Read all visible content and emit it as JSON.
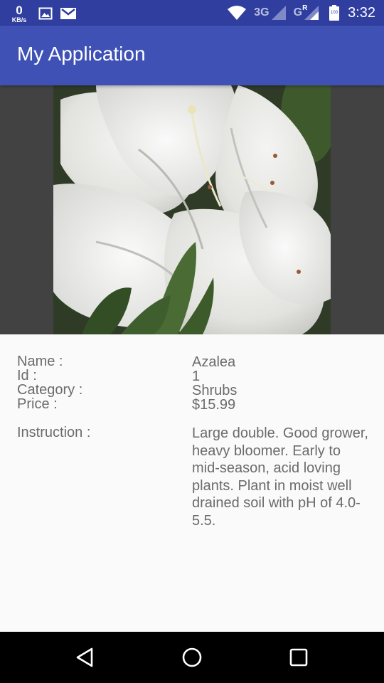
{
  "status_bar": {
    "net_speed_value": "0",
    "net_speed_unit": "KB/s",
    "network_3g_label": "3G",
    "network_g_label": "G",
    "roaming_label": "R",
    "battery_level": "100",
    "clock": "3:32",
    "icons": [
      "image-icon",
      "gmail-icon",
      "wifi-icon",
      "signal-icon",
      "battery-icon"
    ]
  },
  "app_bar": {
    "title": "My Application"
  },
  "plant": {
    "image_icon": "plant-photo"
  },
  "details": {
    "name_label": "Name :",
    "name_value": "Azalea",
    "id_label": "Id :",
    "id_value": "1",
    "category_label": "Category :",
    "category_value": "Shrubs",
    "price_label": "Price :",
    "price_value": "$15.99",
    "instruction_label": "Instruction :",
    "instruction_value": "Large double. Good grower, heavy bloomer. Early to mid-season, acid loving plants. Plant in moist well drained soil with pH of 4.0-5.5."
  },
  "nav_bar": {
    "icons": [
      "back-icon",
      "home-icon",
      "recents-icon"
    ]
  },
  "colors": {
    "status_bar": "#303f9f",
    "app_bar": "#3f51b5",
    "image_background": "#424242",
    "content_background": "#fafafa",
    "text": "#6b6b6b",
    "nav_bar": "#000000"
  }
}
